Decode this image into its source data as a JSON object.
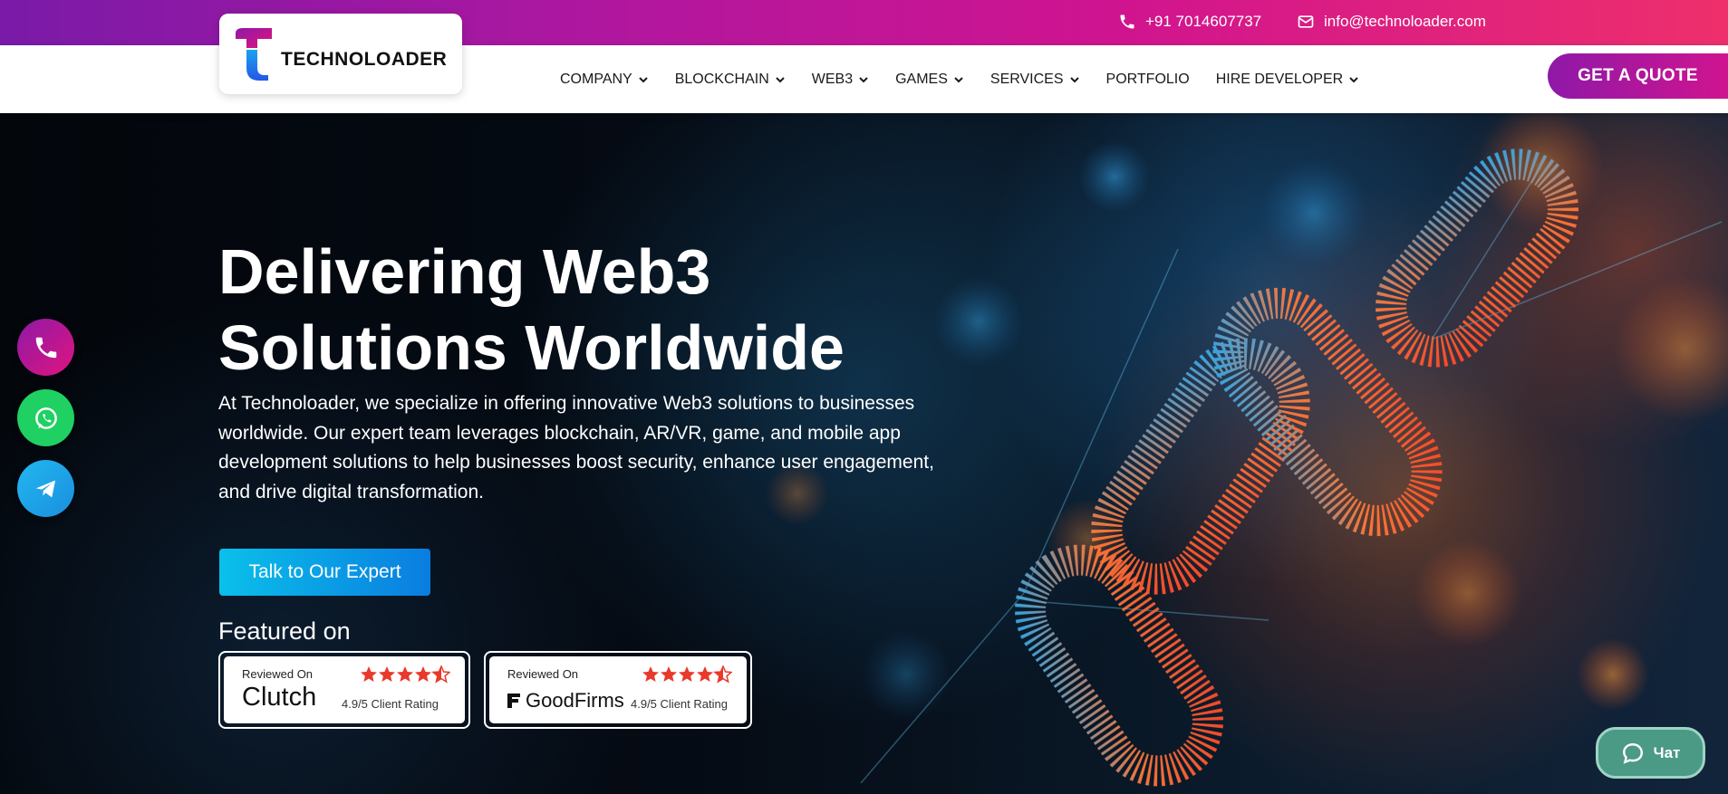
{
  "topbar": {
    "phone": "+91 7014607737",
    "email": "info@technoloader.com"
  },
  "logo": {
    "text": "TECHNOLOADER"
  },
  "nav": {
    "items": [
      {
        "label": "COMPANY",
        "dropdown": true
      },
      {
        "label": "BLOCKCHAIN",
        "dropdown": true
      },
      {
        "label": "WEB3",
        "dropdown": true
      },
      {
        "label": "GAMES",
        "dropdown": true
      },
      {
        "label": "SERVICES",
        "dropdown": true
      },
      {
        "label": "PORTFOLIO",
        "dropdown": false
      },
      {
        "label": "HIRE DEVELOPER",
        "dropdown": true
      }
    ],
    "quote_label": "GET A QUOTE"
  },
  "hero": {
    "title_line1": "Delivering Web3",
    "title_line2": "Solutions Worldwide",
    "lead": "At Technoloader, we specialize in offering innovative Web3 solutions to businesses worldwide. Our expert team leverages blockchain, AR/VR, game, and mobile app development solutions to help businesses boost security, enhance user engagement, and drive digital transformation.",
    "cta_label": "Talk to Our Expert",
    "featured_label": "Featured on"
  },
  "badges": [
    {
      "reviewed": "Reviewed On",
      "brand": "Clutch",
      "rating_text": "4.9/5 Client Rating",
      "stars": 4.5
    },
    {
      "reviewed": "Reviewed On",
      "brand": "GoodFirms",
      "rating_text": "4.9/5 Client Rating",
      "stars": 4.5
    }
  ],
  "side_icons": [
    "phone-icon",
    "whatsapp-icon",
    "telegram-icon"
  ],
  "chat": {
    "label": "Чат"
  },
  "colors": {
    "brand_gradient_start": "#7a1aa8",
    "brand_gradient_end": "#ee2f6c",
    "cta_blue": "#0a9de0",
    "chat_green": "#4a9a86",
    "star_red": "#e8392b"
  }
}
